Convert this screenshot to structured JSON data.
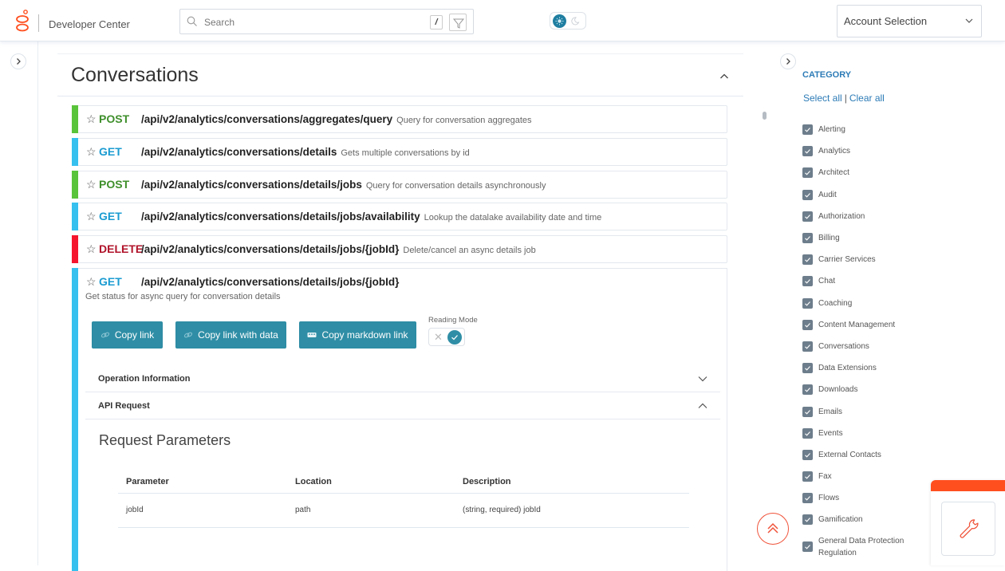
{
  "header": {
    "brand": "Developer Center",
    "search_placeholder": "Search",
    "search_shortcut": "/",
    "account_selection": "Account Selection"
  },
  "section": {
    "title": "Conversations"
  },
  "endpoints": [
    {
      "method": "POST",
      "path": "/api/v2/analytics/conversations/aggregates/query",
      "description": "Query for conversation aggregates",
      "color": "#59c33a",
      "method_color": "#3f8f2c"
    },
    {
      "method": "GET",
      "path": "/api/v2/analytics/conversations/details",
      "description": "Gets multiple conversations by id",
      "color": "#36c0ef",
      "method_color": "#1a9bd1"
    },
    {
      "method": "POST",
      "path": "/api/v2/analytics/conversations/details/jobs",
      "description": "Query for conversation details asynchronously",
      "color": "#59c33a",
      "method_color": "#3f8f2c"
    },
    {
      "method": "GET",
      "path": "/api/v2/analytics/conversations/details/jobs/availability",
      "description": "Lookup the datalake availability date and time",
      "color": "#36c0ef",
      "method_color": "#1a9bd1"
    },
    {
      "method": "DELETE",
      "path": "/api/v2/analytics/conversations/details/jobs/{jobId}",
      "description": "Delete/cancel an async details job",
      "color": "#f5152d",
      "method_color": "#b0132a"
    }
  ],
  "expanded_endpoint": {
    "method": "GET",
    "path": "/api/v2/analytics/conversations/details/jobs/{jobId}",
    "description": "Get status for async query for conversation details",
    "color": "#36c0ef",
    "method_color": "#1a9bd1",
    "buttons": {
      "copy_link": "Copy link",
      "copy_link_with_data": "Copy link with data",
      "copy_markdown_link": "Copy markdown link"
    },
    "reading_mode_label": "Reading Mode",
    "reading_mode_on": true,
    "accordions": [
      {
        "title": "Operation Information",
        "expanded": false
      },
      {
        "title": "API Request",
        "expanded": true
      }
    ],
    "request_parameters_title": "Request Parameters",
    "parameters_table": {
      "columns": [
        "Parameter",
        "Location",
        "Description"
      ],
      "rows": [
        [
          "jobId",
          "path",
          "(string, required) jobId"
        ]
      ]
    }
  },
  "sidebar": {
    "title": "CATEGORY",
    "select_all": "Select all",
    "separator": "|",
    "clear_all": "Clear all",
    "categories": [
      {
        "label": "Alerting",
        "checked": true
      },
      {
        "label": "Analytics",
        "checked": true
      },
      {
        "label": "Architect",
        "checked": true
      },
      {
        "label": "Audit",
        "checked": true
      },
      {
        "label": "Authorization",
        "checked": true
      },
      {
        "label": "Billing",
        "checked": true
      },
      {
        "label": "Carrier Services",
        "checked": true
      },
      {
        "label": "Chat",
        "checked": true
      },
      {
        "label": "Coaching",
        "checked": true
      },
      {
        "label": "Content Management",
        "checked": true
      },
      {
        "label": "Conversations",
        "checked": true
      },
      {
        "label": "Data Extensions",
        "checked": true
      },
      {
        "label": "Downloads",
        "checked": true
      },
      {
        "label": "Emails",
        "checked": true
      },
      {
        "label": "Events",
        "checked": true
      },
      {
        "label": "External Contacts",
        "checked": true
      },
      {
        "label": "Fax",
        "checked": true
      },
      {
        "label": "Flows",
        "checked": true
      },
      {
        "label": "Gamification",
        "checked": true
      },
      {
        "label": "General Data Protection Regulation",
        "checked": true
      }
    ]
  },
  "colors": {
    "accent": "#2f8ea6",
    "brand_orange": "#ff4f1f",
    "link_blue": "#2c7bb6"
  }
}
